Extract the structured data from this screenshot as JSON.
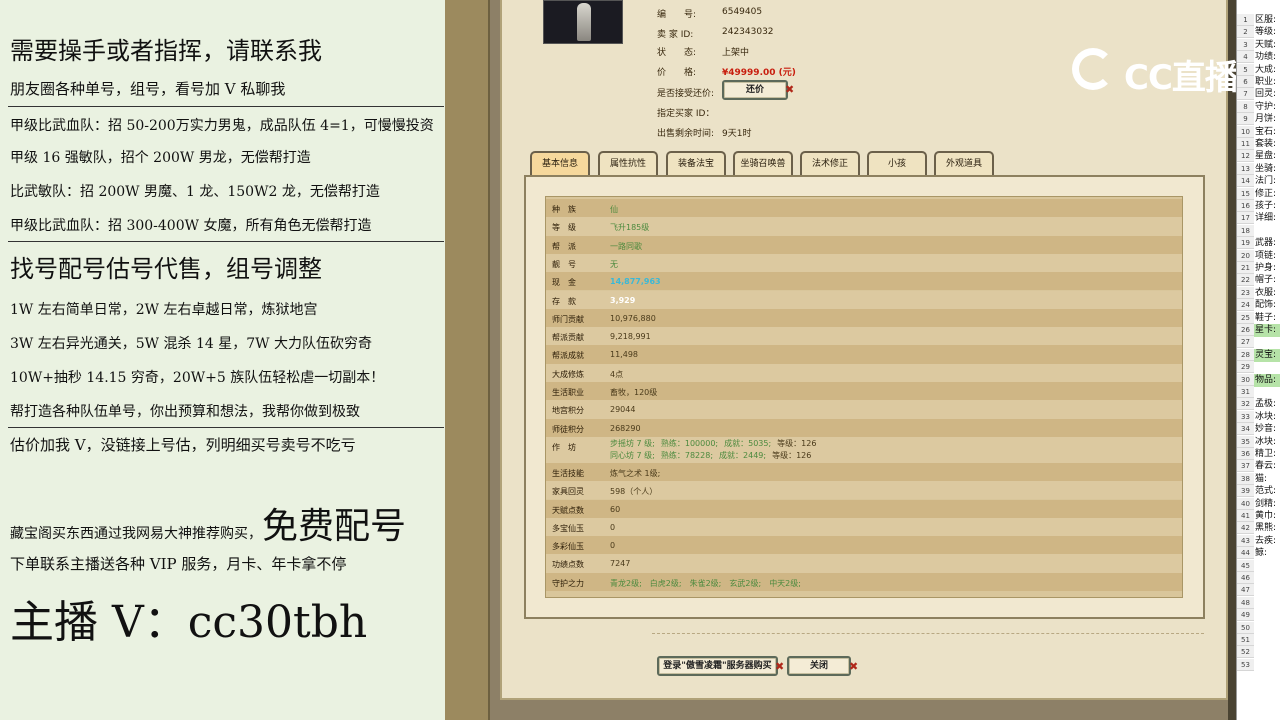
{
  "promo": {
    "line1": "需要操手或者指挥，请联系我",
    "line2": "朋友圈各种单号，组号，看号加 V 私聊我",
    "line3": "甲级比武血队：招 50-200万实力男鬼，成品队伍 4=1，可慢慢投资",
    "line4": "甲级 16 强敏队，招个 200W 男龙，无偿帮打造",
    "line5": "比武敏队：招 200W 男魔、1 龙、150W2 龙，无偿帮打造",
    "line6": "甲级比武血队：招 300-400W 女魔，所有角色无偿帮打造",
    "line7": "找号配号估号代售，组号调整",
    "line8": "1W 左右简单日常，2W 左右卓越日常，炼狱地宫",
    "line9": "3W 左右异光通关，5W 混杀 14 星，7W 大力队伍砍穷奇",
    "line10": "10W+抽秒 14.15 穷奇，20W+5 族队伍轻松虐一切副本！",
    "line11": "帮打造各种队伍单号，你出预算和想法，我帮你做到极致",
    "line12": "估价加我 V，没链接上号估，列明细买号卖号不吃亏",
    "line13a": "藏宝阁买东西通过我网易大神推荐购买，",
    "line13b": "免费配号",
    "line14": "下单联系主播送各种 VIP 服务，月卡、年卡拿不停",
    "line15": "主播 V：cc30tbh"
  },
  "listing": {
    "fields": [
      {
        "label": "编　　号:",
        "value": "6549405"
      },
      {
        "label": "卖 家 ID:",
        "value": "242343032"
      },
      {
        "label": "状　　态:",
        "value": "上架中"
      },
      {
        "label": "价　　格:",
        "value": "¥49999.00 (元)"
      }
    ],
    "accept_bargain_label": "是否接受还价:",
    "bargain_button": "还价",
    "designated_buyer_label": "指定买家 ID：",
    "time_left_label": "出售剩余时间:",
    "time_left_value": "9天1时"
  },
  "tabs": [
    "基本信息",
    "属性抗性",
    "装备法宝",
    "坐骑召唤兽",
    "法术修正",
    "小孩",
    "外观道具"
  ],
  "rows": [
    {
      "k": "种　族",
      "v": "仙"
    },
    {
      "k": "等　级",
      "v": "飞升185级"
    },
    {
      "k": "帮　派",
      "v": "一路同歌"
    },
    {
      "k": "靓　号",
      "v": "无"
    },
    {
      "k": "现　金",
      "v": "14,877,963"
    },
    {
      "k": "存　款",
      "v": "3,929"
    },
    {
      "k": "师门贡献",
      "v": "10,976,880"
    },
    {
      "k": "帮派贡献",
      "v": "9,218,991"
    },
    {
      "k": "帮派成就",
      "v": "11,498"
    },
    {
      "k": "大成修炼",
      "v": "4点"
    },
    {
      "k": "生活职业",
      "v": "畜牧，120级"
    },
    {
      "k": "地宫积分",
      "v": "29044"
    },
    {
      "k": "师徒积分",
      "v": "268290"
    },
    {
      "k": "作　坊",
      "v": ""
    },
    {
      "k": "生活技能",
      "v": "炼气之术 1级;"
    },
    {
      "k": "家具回灵",
      "v": "598（个人）"
    },
    {
      "k": "天赋点数",
      "v": "60"
    },
    {
      "k": "多宝仙玉",
      "v": "0"
    },
    {
      "k": "多彩仙玉",
      "v": "0"
    },
    {
      "k": "功绩点数",
      "v": "7247"
    },
    {
      "k": "守护之力",
      "v": ""
    }
  ],
  "workshop": {
    "line1_a": "步摇坊 7 级;",
    "line1_b": "熟练：100000;",
    "line1_c": "成就：5035;",
    "line1_d": "等级：126",
    "line2_a": "同心坊 7 级;",
    "line2_b": "熟练：78228;",
    "line2_c": "成就：2449;",
    "line2_d": "等级：126"
  },
  "guardians": [
    "青龙2级;",
    "白虎2级;",
    "朱雀2级;",
    "玄武2级;",
    "中天2级;"
  ],
  "buttons": {
    "login_buy": "登录\"傲雪凌霜\"服务器购买",
    "close": "关闭"
  },
  "logo_text": "CC直播",
  "sheet": {
    "row_numbers": [
      "1",
      "2",
      "3",
      "4",
      "5",
      "6",
      "7",
      "8",
      "9",
      "10",
      "11",
      "12",
      "13",
      "14",
      "15",
      "16",
      "17",
      "18",
      "19",
      "20",
      "21",
      "22",
      "23",
      "24",
      "25",
      "26",
      "27",
      "28",
      "29",
      "30",
      "31",
      "32",
      "33",
      "34",
      "35",
      "36",
      "37",
      "38",
      "39",
      "40",
      "41",
      "42",
      "43",
      "44",
      "45",
      "46",
      "47",
      "48",
      "49",
      "50",
      "51",
      "52",
      "53"
    ],
    "cells": [
      "区服:",
      "等级:",
      "天赋:",
      "功绩:",
      "大成:",
      "职业:",
      "回灵:",
      "守护:",
      "月饼:",
      "宝石:",
      "套装:",
      "星盘:",
      "坐骑:",
      "法门:",
      "修正:",
      "孩子:",
      "详细:",
      "",
      "武器:",
      "项链:",
      "护身:",
      "帽子:",
      "衣服:",
      "配饰:",
      "鞋子:",
      "星卡:",
      "",
      "灵宝:",
      "",
      "物品:",
      "",
      "孟极:",
      "冰块:",
      "妙音:",
      "冰块:",
      "精卫:",
      "春云:",
      "猫:",
      "范式:",
      "剑精:",
      "黄巾:",
      "黑熊:",
      "去疾:",
      "鲸:",
      "",
      "",
      "",
      "",
      "",
      "",
      "",
      "",
      ""
    ]
  },
  "colors": {
    "promo_bg": "#eaf2e1",
    "price": "#c81e0e",
    "cash": "#3cb8d6",
    "accent_green": "#4c8a3e"
  }
}
